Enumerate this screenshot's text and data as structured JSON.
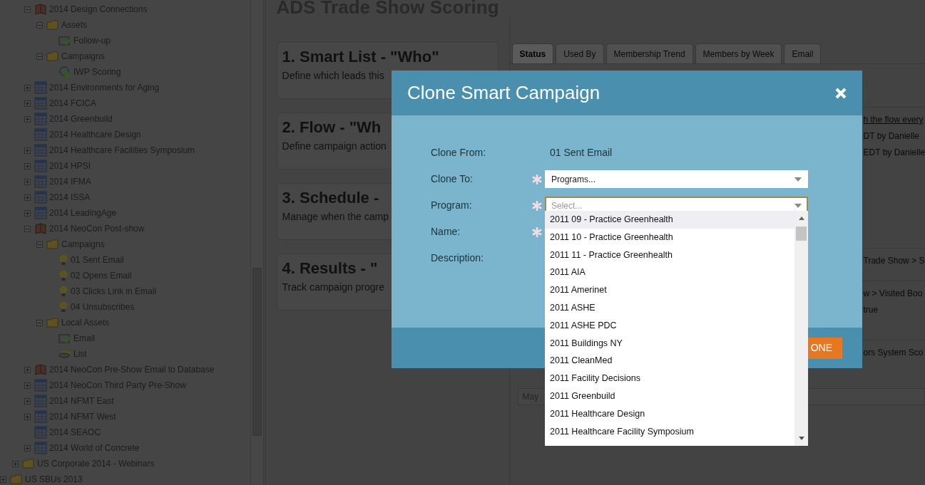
{
  "tree": [
    {
      "children": [
        {
          "children": [
            {
              "label": "2014 Design Connections",
              "kind": "program",
              "expanded": true,
              "children": [
                {
                  "label": "Assets",
                  "kind": "folder",
                  "expanded": true,
                  "children": [
                    {
                      "label": "Follow-up",
                      "kind": "email"
                    }
                  ]
                },
                {
                  "label": "Campaigns",
                  "kind": "folder",
                  "expanded": true,
                  "children": [
                    {
                      "label": "IWP Scoring",
                      "kind": "campaign"
                    }
                  ]
                }
              ]
            },
            {
              "label": "2014 Environments for Aging",
              "kind": "event",
              "expanded": false
            },
            {
              "label": "2014 FCICA",
              "kind": "event",
              "expanded": false
            },
            {
              "label": "2014 Greenbuild",
              "kind": "event",
              "expanded": false
            },
            {
              "label": "2014 Healthcare Design",
              "kind": "event"
            },
            {
              "label": "2014 Healthcare Facilities Symposium",
              "kind": "event",
              "expanded": false
            },
            {
              "label": "2014 HPSI",
              "kind": "event",
              "expanded": false
            },
            {
              "label": "2014 IFMA",
              "kind": "event",
              "expanded": false
            },
            {
              "label": "2014 ISSA",
              "kind": "event",
              "expanded": false
            },
            {
              "label": "2014 LeadingAge",
              "kind": "event",
              "expanded": false
            },
            {
              "label": "2014 NeoCon Post-show",
              "kind": "program",
              "expanded": true,
              "children": [
                {
                  "label": "Campaigns",
                  "kind": "folder",
                  "expanded": true,
                  "children": [
                    {
                      "label": "01 Sent Email",
                      "kind": "bulb"
                    },
                    {
                      "label": "02 Opens Email",
                      "kind": "bulb"
                    },
                    {
                      "label": "03 Clicks Link in Email",
                      "kind": "bulb"
                    },
                    {
                      "label": "04 Unsubscribes",
                      "kind": "bulb"
                    }
                  ]
                },
                {
                  "label": "Local Assets",
                  "kind": "folder",
                  "expanded": true,
                  "children": [
                    {
                      "label": "Email",
                      "kind": "email"
                    },
                    {
                      "label": "List",
                      "kind": "list"
                    }
                  ]
                }
              ]
            },
            {
              "label": "2014 NeoCon Pre-Show Email to Database",
              "kind": "program",
              "expanded": false
            },
            {
              "label": "2014 NeoCon Third Party Pre-Show",
              "kind": "event",
              "expanded": false
            },
            {
              "label": "2014 NFMT East",
              "kind": "event",
              "expanded": false
            },
            {
              "label": "2014 NFMT West",
              "kind": "event",
              "expanded": false
            },
            {
              "label": "2014 SEAOC",
              "kind": "event"
            },
            {
              "label": "2014 World of Concrete",
              "kind": "event",
              "expanded": false
            }
          ]
        },
        {
          "label": "US Corporate 2014 - Webinars",
          "kind": "folder",
          "expanded": false
        }
      ]
    },
    {
      "label": "US SBUs 2013",
      "kind": "folder",
      "expanded": false
    }
  ],
  "page_title": "ADS Trade Show Scoring",
  "cards": [
    {
      "title": "1. Smart List - \"Who\"",
      "description": "Define which leads this"
    },
    {
      "title": "2. Flow - \"Wh",
      "description": "Define campaign action"
    },
    {
      "title": "3. Schedule -",
      "description": "Manage when the camp"
    },
    {
      "title": "4. Results - \"",
      "description": "Track campaign progre"
    }
  ],
  "tabs": [
    {
      "label": "Status",
      "selected": true
    },
    {
      "label": "Used By",
      "selected": false
    },
    {
      "label": "Membership Trend",
      "selected": false
    },
    {
      "label": "Members by Week",
      "selected": false
    },
    {
      "label": "Email",
      "selected": false
    }
  ],
  "status_sections": [
    [
      {
        "text": "h the flow every",
        "kind": "link"
      },
      {
        "text": "DT by Danielle",
        "kind": "text"
      },
      {
        "text": "EDT by Danielle",
        "kind": "text"
      }
    ],
    [
      {
        "text": "Trade Show > S",
        "kind": "text"
      }
    ],
    [
      {
        "text": "w > Visited Boo",
        "kind": "text"
      },
      {
        "text": "true",
        "kind": "text"
      }
    ],
    [
      {
        "text": "ors System Sco",
        "kind": "text"
      }
    ]
  ],
  "status_table_cell": "May",
  "dialog": {
    "title": "Clone Smart Campaign",
    "fields": [
      {
        "label": "Clone From:",
        "kind": "text",
        "value": "01 Sent Email",
        "required": false
      },
      {
        "label": "Clone To:",
        "kind": "select",
        "value": "Programs...",
        "required": true,
        "focused": false
      },
      {
        "label": "Program:",
        "kind": "select",
        "placeholder": "Select...",
        "required": true,
        "focused": true
      },
      {
        "label": "Name:",
        "kind": "label",
        "required": true
      },
      {
        "label": "Description:",
        "kind": "label",
        "required": false
      }
    ],
    "dropdown": [
      {
        "label": "2011 09 - Practice Greenhealth",
        "selected": true
      },
      {
        "label": "2011 10 - Practice Greenhealth",
        "selected": false
      },
      {
        "label": "2011 11 - Practice Greenhealth",
        "selected": false
      },
      {
        "label": "2011 AIA",
        "selected": false
      },
      {
        "label": "2011 Amerinet",
        "selected": false
      },
      {
        "label": "2011 ASHE",
        "selected": false
      },
      {
        "label": "2011 ASHE PDC",
        "selected": false
      },
      {
        "label": "2011 Buildings NY",
        "selected": false
      },
      {
        "label": "2011 CleanMed",
        "selected": false
      },
      {
        "label": "2011 Facility Decisions",
        "selected": false
      },
      {
        "label": "2011 Greenbuild",
        "selected": false
      },
      {
        "label": "2011 Healthcare Design",
        "selected": false
      },
      {
        "label": "2011 Healthcare Facility Symposium",
        "selected": false
      }
    ],
    "button": "ONE"
  }
}
